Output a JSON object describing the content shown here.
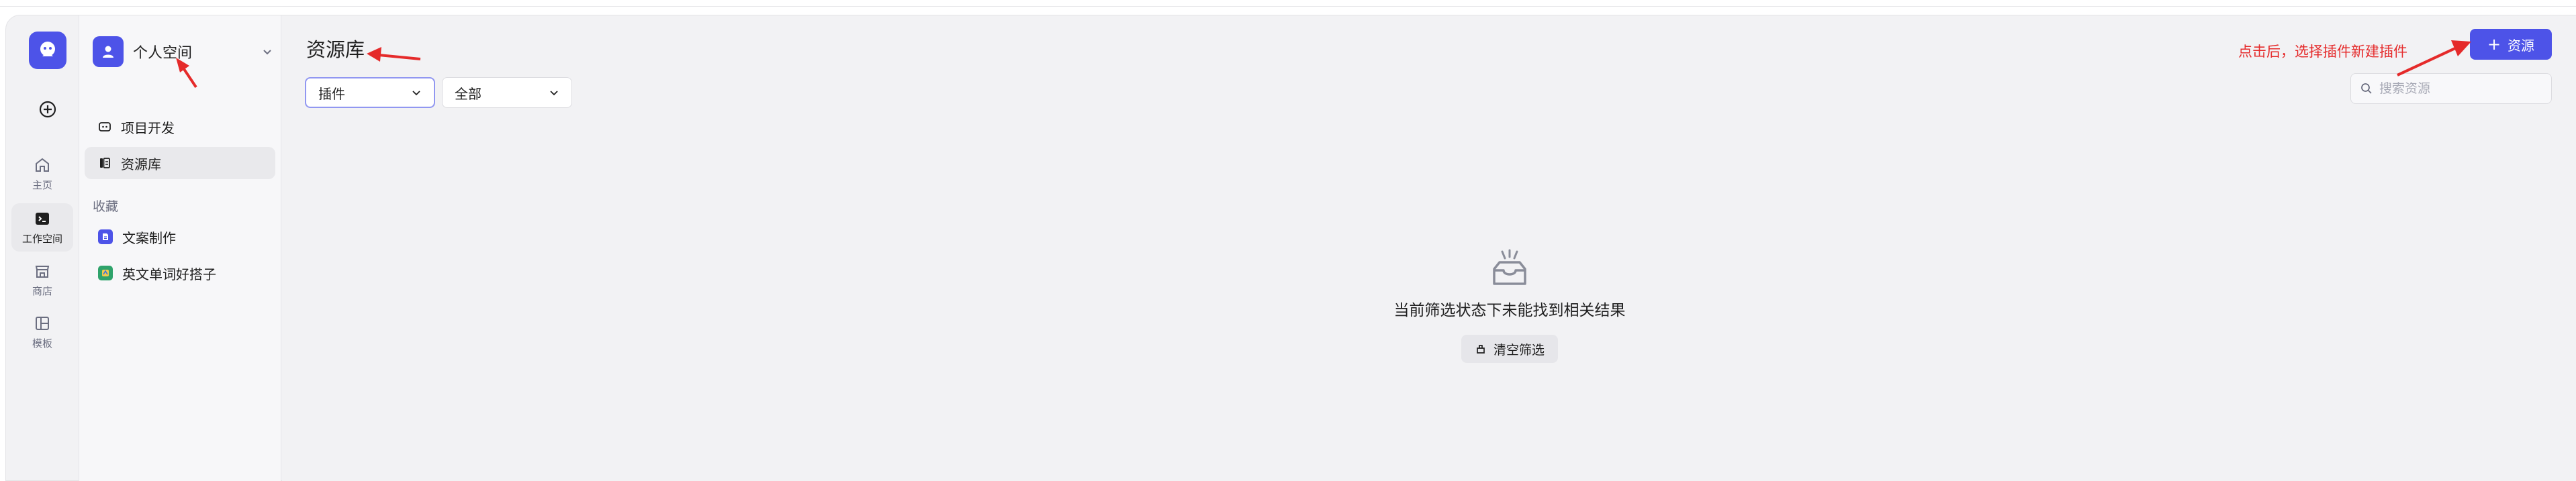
{
  "rail": {
    "items": [
      {
        "label": "主页",
        "icon": "home-icon"
      },
      {
        "label": "工作空间",
        "icon": "workspace-icon"
      },
      {
        "label": "商店",
        "icon": "store-icon"
      },
      {
        "label": "模板",
        "icon": "template-icon"
      }
    ]
  },
  "workspace": {
    "name": "个人空间"
  },
  "nav": {
    "items": [
      {
        "label": "项目开发"
      },
      {
        "label": "资源库"
      }
    ],
    "favorites_title": "收藏",
    "favorites": [
      {
        "label": "文案制作",
        "icon_color": "#4d53e8"
      },
      {
        "label": "英文单词好搭子",
        "icon_color": "#2fa36b"
      }
    ]
  },
  "main": {
    "title": "资源库",
    "filter_type": "插件",
    "filter_scope": "全部",
    "search_placeholder": "搜索资源",
    "add_button": "资源",
    "annotation": "点击后，选择插件新建插件",
    "empty_text": "当前筛选状态下未能找到相关结果",
    "clear_button": "清空筛选"
  },
  "colors": {
    "accent": "#4d53e8",
    "annotation": "#e52a2a"
  }
}
